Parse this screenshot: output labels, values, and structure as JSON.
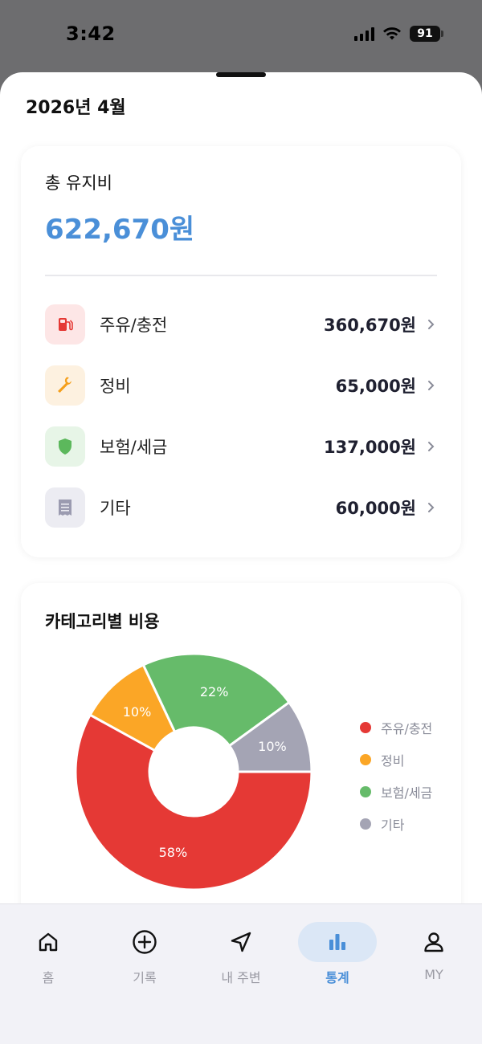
{
  "status": {
    "time": "3:42",
    "battery": "91"
  },
  "header": {
    "month_title": "2026년 4월"
  },
  "summary": {
    "label": "총 유지비",
    "total": "622,670원",
    "categories": [
      {
        "name": "주유/충전",
        "amount": "360,670원",
        "icon": "fuel-pump-icon",
        "color": "#e53935",
        "bg": "#fde6e6"
      },
      {
        "name": "정비",
        "amount": "65,000원",
        "icon": "wrench-icon",
        "color": "#f59f1b",
        "bg": "#fdf1e0"
      },
      {
        "name": "보험/세금",
        "amount": "137,000원",
        "icon": "shield-icon",
        "color": "#5cb85c",
        "bg": "#e7f5e7"
      },
      {
        "name": "기타",
        "amount": "60,000원",
        "icon": "receipt-icon",
        "color": "#9b9bb0",
        "bg": "#ececf2"
      }
    ]
  },
  "chart_card": {
    "title": "카테고리별 비용"
  },
  "chart_data": {
    "type": "pie",
    "donut": true,
    "categories": [
      "주유/충전",
      "정비",
      "보험/세금",
      "기타"
    ],
    "values": [
      58,
      10,
      22,
      10
    ],
    "labels": [
      "58%",
      "10%",
      "22%",
      "10%"
    ],
    "colors": [
      "#e53935",
      "#fba626",
      "#66bb6a",
      "#a4a4b4"
    ],
    "legend_position": "right"
  },
  "tabs": [
    {
      "label": "홈",
      "icon": "home-icon",
      "active": false
    },
    {
      "label": "기록",
      "icon": "plus-circle-icon",
      "active": false
    },
    {
      "label": "내 주변",
      "icon": "navigation-arrow-icon",
      "active": false
    },
    {
      "label": "통계",
      "icon": "bar-chart-icon",
      "active": true
    },
    {
      "label": "MY",
      "icon": "user-icon",
      "active": false
    }
  ],
  "theme": {
    "accent": "#4a8fd8"
  }
}
